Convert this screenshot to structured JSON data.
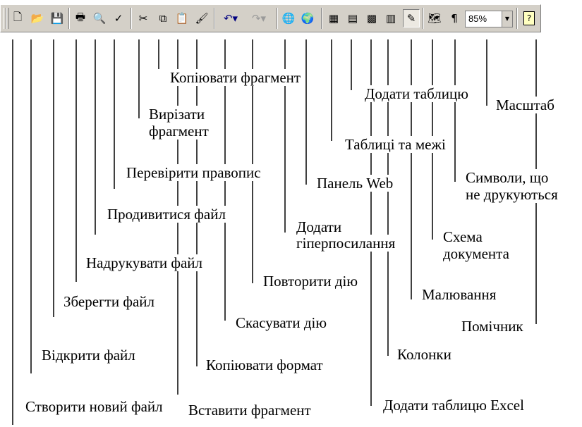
{
  "toolbar": {
    "buttons": [
      {
        "name": "new-file-icon",
        "glyph": "🗋"
      },
      {
        "name": "open-folder-icon",
        "glyph": "📂"
      },
      {
        "name": "save-disk-icon",
        "glyph": "💾"
      },
      {
        "name": "print-icon",
        "glyph": "🖶"
      },
      {
        "name": "print-preview-icon",
        "glyph": "🔍"
      },
      {
        "name": "spell-check-icon",
        "glyph": "✓"
      },
      {
        "name": "cut-scissors-icon",
        "glyph": "✂"
      },
      {
        "name": "copy-icon",
        "glyph": "⧉"
      },
      {
        "name": "paste-icon",
        "glyph": "📋"
      },
      {
        "name": "format-painter-icon",
        "glyph": "🖌"
      },
      {
        "name": "undo-icon",
        "glyph": "↶▾"
      },
      {
        "name": "redo-icon",
        "glyph": "↷▾"
      },
      {
        "name": "hyperlink-globe-icon",
        "glyph": "🌐"
      },
      {
        "name": "web-toolbar-icon",
        "glyph": "🌍"
      },
      {
        "name": "tables-borders-icon",
        "glyph": "▦"
      },
      {
        "name": "insert-table-icon",
        "glyph": "▤"
      },
      {
        "name": "insert-excel-icon",
        "glyph": "▩"
      },
      {
        "name": "columns-icon",
        "glyph": "▥"
      },
      {
        "name": "drawing-icon",
        "glyph": "✎"
      },
      {
        "name": "document-map-icon",
        "glyph": "🗺"
      },
      {
        "name": "show-hide-pilcrow-icon",
        "glyph": "¶"
      },
      {
        "name": "assistant-help-icon",
        "glyph": "?"
      }
    ],
    "zoom_value": "85%",
    "zoom_arrow": "▼"
  },
  "labels": {
    "new_file": "Створити новий файл",
    "open_file": "Відкрити файл",
    "save_file": "Зберегти файл",
    "print_file": "Надрукувати файл",
    "preview_file": "Продивитися файл",
    "spell_check": "Перевірити правопис",
    "cut_fragment_1": "Вирізати",
    "cut_fragment_2": "фрагмент",
    "copy_fragment": "Копіювати фрагмент",
    "paste_fragment": "Вставити фрагмент",
    "copy_format": "Копіювати формат",
    "undo": "Скасувати дію",
    "redo": "Повторити дію",
    "hyperlink_1": "Додати",
    "hyperlink_2": "гіперпосилання",
    "web_panel": "Панель Web",
    "tables_borders": "Таблиці та межі",
    "add_table": "Додати таблицю",
    "add_excel": "Додати таблицю Excel",
    "columns": "Колонки",
    "drawing": "Малювання",
    "doc_map_1": "Схема",
    "doc_map_2": "документа",
    "nonprinting_1": "Символи, що",
    "nonprinting_2": "не друкуються",
    "zoom": "Масштаб",
    "assistant": "Помічник"
  }
}
